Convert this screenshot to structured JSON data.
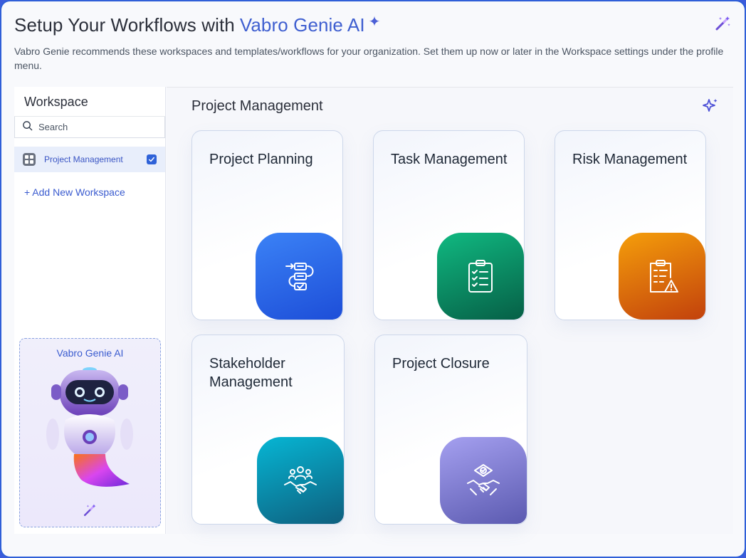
{
  "header": {
    "title_prefix": "Setup Your Workflows with",
    "title_accent": "Vabro Genie AI",
    "sparkle": "✦",
    "subtitle": "Vabro Genie recommends these workspaces and templates/workflows for your organization. Set them up now or later in the Workspace settings under the profile menu.",
    "wand_icon": "magic-wand-icon"
  },
  "sidebar": {
    "title": "Workspace",
    "search_placeholder": "Search",
    "items": [
      {
        "label": "Project Management",
        "checked": true
      }
    ],
    "add_label": "+ Add New Workspace",
    "genie": {
      "title": "Vabro Genie AI"
    }
  },
  "main": {
    "section_title": "Project Management",
    "cards": [
      {
        "title": "Project Planning",
        "icon": "workflow-icon",
        "color": "#2f62e8"
      },
      {
        "title": "Task Management",
        "icon": "clipboard-checklist-icon",
        "color": "#0a8f5f"
      },
      {
        "title": "Risk Management",
        "icon": "risk-clipboard-icon",
        "color": "#e07a10"
      },
      {
        "title": "Stakeholder Management",
        "icon": "handshake-team-icon",
        "color": "#0e86aa"
      },
      {
        "title": "Project Closure",
        "icon": "handshake-certificate-icon",
        "color": "#7c78d0"
      }
    ]
  },
  "colors": {
    "accent": "#3f5fd0",
    "frame": "#2f5fd8"
  }
}
